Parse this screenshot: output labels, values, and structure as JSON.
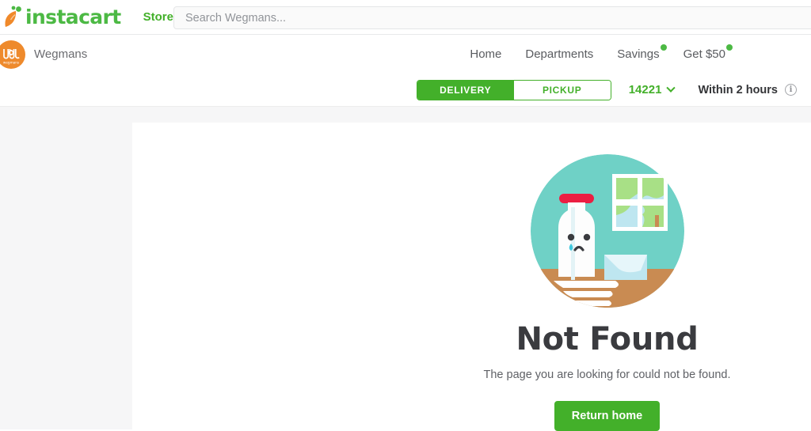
{
  "header": {
    "logo_text": "instacart",
    "logo_icon": "carrot-icon",
    "stores_label": "Stores",
    "stores_chevron": "chevron-down-icon",
    "search": {
      "value": "",
      "placeholder": "Search Wegmans..."
    }
  },
  "storebar": {
    "store_name": "Wegmans",
    "store_logo_text": "wegmans",
    "nav": [
      {
        "label": "Home",
        "badge": false
      },
      {
        "label": "Departments",
        "badge": false
      },
      {
        "label": "Savings",
        "badge": true
      },
      {
        "label": "Get $50",
        "badge": true
      }
    ]
  },
  "deliverybar": {
    "delivery_label": "DELIVERY",
    "pickup_label": "PICKUP",
    "active_mode": "DELIVERY",
    "zip": "14221",
    "zip_chevron": "chevron-down-icon",
    "eta": "Within 2 hours",
    "info_icon": "info-circle-icon",
    "info_glyph": "i"
  },
  "main": {
    "illustration_name": "sad-milk-bottle-illustration",
    "title": "Not Found",
    "subtitle": "The page you are looking for could not be found.",
    "button_label": "Return home"
  },
  "colors": {
    "brand_green": "#43B02A",
    "logo_green": "#4CB944",
    "wegmans_orange": "#EE8A2C",
    "illus_teal": "#6FD1C6",
    "illus_red_cap": "#EB1E42",
    "illus_table_brown": "#C98B52",
    "illus_tear_blue": "#3EC8DE",
    "page_bg": "#f6f6f7",
    "title_gray": "#3A3B3F"
  }
}
